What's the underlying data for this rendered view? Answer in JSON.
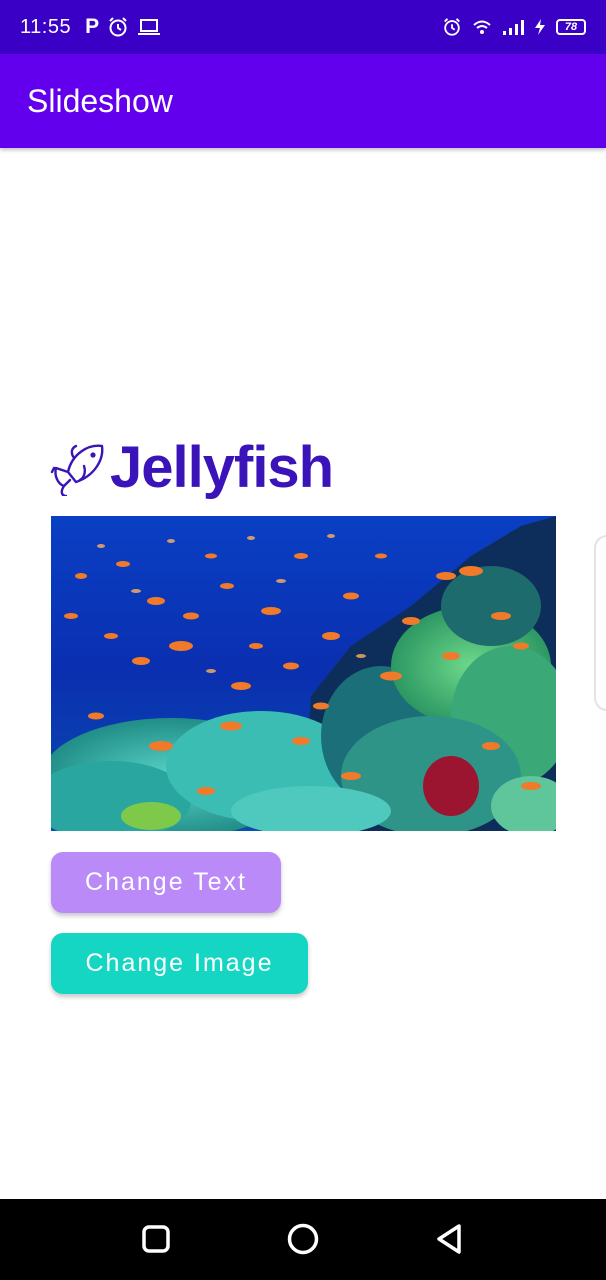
{
  "status_bar": {
    "time": "11:55",
    "left_icons": [
      "parking-icon",
      "alarm-icon",
      "laptop-icon"
    ],
    "right_icons": [
      "alarm-icon",
      "wifi-icon",
      "signal-icon",
      "charging-icon"
    ],
    "battery_level": "78"
  },
  "app_bar": {
    "title": "Slideshow",
    "color": "#6200ee"
  },
  "slide": {
    "heading": "Jellyfish",
    "heading_icon": "fish-icon",
    "heading_color": "#3a14b8",
    "image": "coral-reef-with-fish"
  },
  "buttons": {
    "change_text": "Change Text",
    "change_image": "Change Image",
    "change_text_color": "#b98af8",
    "change_image_color": "#15d6c3"
  },
  "nav_bar": {
    "buttons": [
      "recents-icon",
      "home-icon",
      "back-icon"
    ]
  }
}
